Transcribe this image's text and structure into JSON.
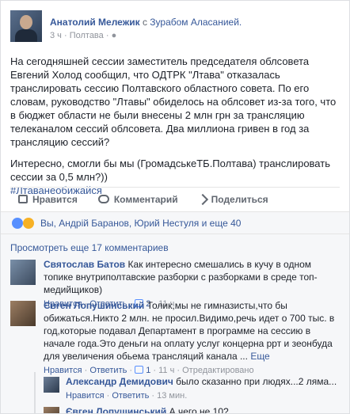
{
  "post": {
    "author": "Анатолий Мележик",
    "with_text": "с",
    "tagged": "Зурабом Аласанией.",
    "time": "3 ч",
    "location": "Полтава",
    "paragraph1": "На сегодняшней сессии заместитель председателя облсовета Евгений Холод сообщил, что ОДТРК \"Лтава\" отказалась транслировать сессию Полтавского областного совета. По его словам, руководство \"Лтавы\" обиделось на облсовет из-за того, что в бюджет области не были внесены 2 млн грн за трансляцию телеканалом сессий облсовета. Два миллиона гривен в год за трансляцию сессий?",
    "paragraph2": "Интересно, смогли бы мы (ГромадськеТБ.Полтава) транслировать сессии за 0,5 млн?))",
    "hashtag": "#Лтаванеобижайся"
  },
  "actions": {
    "like": "Нравится",
    "comment": "Комментарий",
    "share": "Поделиться"
  },
  "likes_text": "Вы, Андрій Баранов, Юрий Нестуля и еще 40",
  "more_comments": "Просмотреть еще 17 комментариев",
  "comments": [
    {
      "author": "Святослав Батов",
      "text": "Как интересно смешались в кучу в одном топике внутриполтавские разборки с разборками в среде топ-медийщиков)",
      "meta_like": "Нравится",
      "meta_reply": "Ответить",
      "meta_count": "2",
      "meta_time": "11 ч"
    },
    {
      "author": "Євген Лопушинський",
      "text": "Толик,мы не гимназисты,что бы обижаться.Никто 2 млн. не просил.Видимо,речь идет о 700 тыс. в год,которые подавал Департамент в программе на сессию в начале года.Это деньги на оплату услуг концерна ррт и зеонбуда для увеличения обьема трансляций канала ...",
      "see_more": "Еще",
      "meta_like": "Нравится",
      "meta_reply": "Ответить",
      "meta_count": "1",
      "meta_time": "11 ч",
      "meta_edited": "Отредактировано"
    }
  ],
  "replies": [
    {
      "author": "Александр Демидович",
      "text": "было сказанно при людях...2 ляма...",
      "meta_like": "Нравится",
      "meta_reply": "Ответить",
      "meta_time": "13 мин."
    },
    {
      "author": "Євген Лопушинський",
      "text": "А чего не 10?"
    }
  ]
}
